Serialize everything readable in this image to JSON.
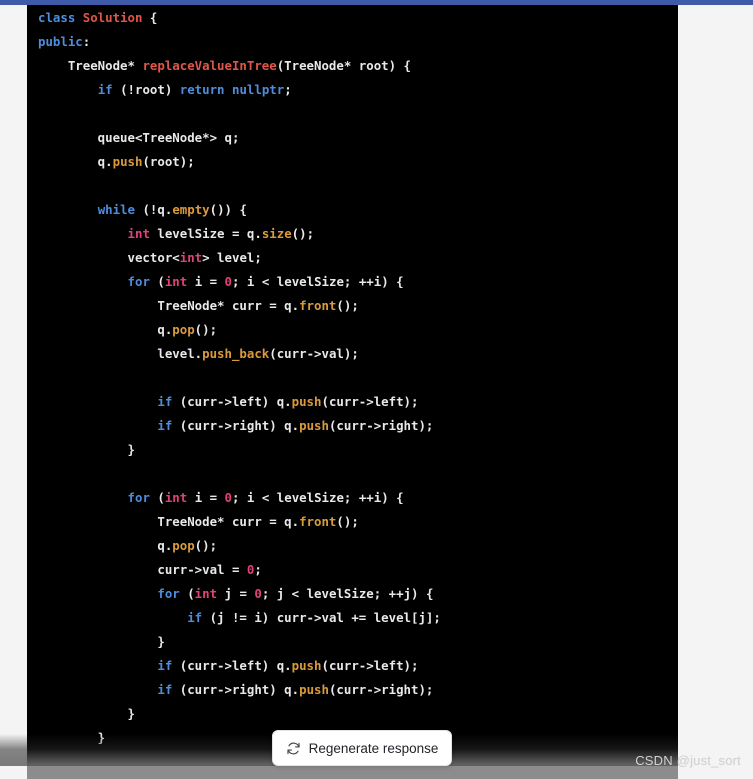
{
  "window": {
    "background_color": "#f4f4f4",
    "accent_bar_color": "#3e5aa9"
  },
  "code_block": {
    "language": "cpp",
    "background_color": "#000000",
    "theme_colors": {
      "keyword": "#4f8ddc",
      "class_name": "#e0564a",
      "function_name": "#e0564a",
      "type": "#e0417c",
      "number": "#e0417c",
      "method": "#d99b3c",
      "plain": "#e9e9e9"
    },
    "lines": [
      [
        {
          "t": "class ",
          "c": "t-key"
        },
        {
          "t": "Solution",
          "c": "t-cls"
        },
        {
          "t": " {",
          "c": "t-plain"
        }
      ],
      [
        {
          "t": "public",
          "c": "t-key"
        },
        {
          "t": ":",
          "c": "t-plain"
        }
      ],
      [
        {
          "t": "    TreeNode* ",
          "c": "t-plain"
        },
        {
          "t": "replaceValueInTree",
          "c": "t-fn"
        },
        {
          "t": "(TreeNode* root) {",
          "c": "t-plain"
        }
      ],
      [
        {
          "t": "        ",
          "c": "t-plain"
        },
        {
          "t": "if",
          "c": "t-key"
        },
        {
          "t": " (!root) ",
          "c": "t-plain"
        },
        {
          "t": "return",
          "c": "t-key"
        },
        {
          "t": " ",
          "c": "t-plain"
        },
        {
          "t": "nullptr",
          "c": "t-key"
        },
        {
          "t": ";",
          "c": "t-plain"
        }
      ],
      [
        {
          "t": "",
          "c": "t-plain"
        }
      ],
      [
        {
          "t": "        queue<TreeNode*> q;",
          "c": "t-plain"
        }
      ],
      [
        {
          "t": "        q.",
          "c": "t-plain"
        },
        {
          "t": "push",
          "c": "t-meth"
        },
        {
          "t": "(root);",
          "c": "t-plain"
        }
      ],
      [
        {
          "t": "",
          "c": "t-plain"
        }
      ],
      [
        {
          "t": "        ",
          "c": "t-plain"
        },
        {
          "t": "while",
          "c": "t-key"
        },
        {
          "t": " (!q.",
          "c": "t-plain"
        },
        {
          "t": "empty",
          "c": "t-meth"
        },
        {
          "t": "()) {",
          "c": "t-plain"
        }
      ],
      [
        {
          "t": "            ",
          "c": "t-plain"
        },
        {
          "t": "int",
          "c": "t-type"
        },
        {
          "t": " levelSize = q.",
          "c": "t-plain"
        },
        {
          "t": "size",
          "c": "t-meth"
        },
        {
          "t": "();",
          "c": "t-plain"
        }
      ],
      [
        {
          "t": "            vector<",
          "c": "t-plain"
        },
        {
          "t": "int",
          "c": "t-type"
        },
        {
          "t": "> level;",
          "c": "t-plain"
        }
      ],
      [
        {
          "t": "            ",
          "c": "t-plain"
        },
        {
          "t": "for",
          "c": "t-key"
        },
        {
          "t": " (",
          "c": "t-plain"
        },
        {
          "t": "int",
          "c": "t-type"
        },
        {
          "t": " i = ",
          "c": "t-plain"
        },
        {
          "t": "0",
          "c": "t-num"
        },
        {
          "t": "; i < levelSize; ++i) {",
          "c": "t-plain"
        }
      ],
      [
        {
          "t": "                TreeNode* curr = q.",
          "c": "t-plain"
        },
        {
          "t": "front",
          "c": "t-meth"
        },
        {
          "t": "();",
          "c": "t-plain"
        }
      ],
      [
        {
          "t": "                q.",
          "c": "t-plain"
        },
        {
          "t": "pop",
          "c": "t-meth"
        },
        {
          "t": "();",
          "c": "t-plain"
        }
      ],
      [
        {
          "t": "                level.",
          "c": "t-plain"
        },
        {
          "t": "push_back",
          "c": "t-meth"
        },
        {
          "t": "(curr->val);",
          "c": "t-plain"
        }
      ],
      [
        {
          "t": "",
          "c": "t-plain"
        }
      ],
      [
        {
          "t": "                ",
          "c": "t-plain"
        },
        {
          "t": "if",
          "c": "t-key"
        },
        {
          "t": " (curr->left) q.",
          "c": "t-plain"
        },
        {
          "t": "push",
          "c": "t-meth"
        },
        {
          "t": "(curr->left);",
          "c": "t-plain"
        }
      ],
      [
        {
          "t": "                ",
          "c": "t-plain"
        },
        {
          "t": "if",
          "c": "t-key"
        },
        {
          "t": " (curr->right) q.",
          "c": "t-plain"
        },
        {
          "t": "push",
          "c": "t-meth"
        },
        {
          "t": "(curr->right);",
          "c": "t-plain"
        }
      ],
      [
        {
          "t": "            }",
          "c": "t-plain"
        }
      ],
      [
        {
          "t": "",
          "c": "t-plain"
        }
      ],
      [
        {
          "t": "            ",
          "c": "t-plain"
        },
        {
          "t": "for",
          "c": "t-key"
        },
        {
          "t": " (",
          "c": "t-plain"
        },
        {
          "t": "int",
          "c": "t-type"
        },
        {
          "t": " i = ",
          "c": "t-plain"
        },
        {
          "t": "0",
          "c": "t-num"
        },
        {
          "t": "; i < levelSize; ++i) {",
          "c": "t-plain"
        }
      ],
      [
        {
          "t": "                TreeNode* curr = q.",
          "c": "t-plain"
        },
        {
          "t": "front",
          "c": "t-meth"
        },
        {
          "t": "();",
          "c": "t-plain"
        }
      ],
      [
        {
          "t": "                q.",
          "c": "t-plain"
        },
        {
          "t": "pop",
          "c": "t-meth"
        },
        {
          "t": "();",
          "c": "t-plain"
        }
      ],
      [
        {
          "t": "                curr->val = ",
          "c": "t-plain"
        },
        {
          "t": "0",
          "c": "t-num"
        },
        {
          "t": ";",
          "c": "t-plain"
        }
      ],
      [
        {
          "t": "                ",
          "c": "t-plain"
        },
        {
          "t": "for",
          "c": "t-key"
        },
        {
          "t": " (",
          "c": "t-plain"
        },
        {
          "t": "int",
          "c": "t-type"
        },
        {
          "t": " j = ",
          "c": "t-plain"
        },
        {
          "t": "0",
          "c": "t-num"
        },
        {
          "t": "; j < levelSize; ++j) {",
          "c": "t-plain"
        }
      ],
      [
        {
          "t": "                    ",
          "c": "t-plain"
        },
        {
          "t": "if",
          "c": "t-key"
        },
        {
          "t": " (j != i) curr->val += level[j];",
          "c": "t-plain"
        }
      ],
      [
        {
          "t": "                }",
          "c": "t-plain"
        }
      ],
      [
        {
          "t": "                ",
          "c": "t-plain"
        },
        {
          "t": "if",
          "c": "t-key"
        },
        {
          "t": " (curr->left) q.",
          "c": "t-plain"
        },
        {
          "t": "push",
          "c": "t-meth"
        },
        {
          "t": "(curr->left);",
          "c": "t-plain"
        }
      ],
      [
        {
          "t": "                ",
          "c": "t-plain"
        },
        {
          "t": "if",
          "c": "t-key"
        },
        {
          "t": " (curr->right) q.",
          "c": "t-plain"
        },
        {
          "t": "push",
          "c": "t-meth"
        },
        {
          "t": "(curr->right);",
          "c": "t-plain"
        }
      ],
      [
        {
          "t": "            }",
          "c": "t-plain"
        }
      ],
      [
        {
          "t": "        }",
          "c": "t-plain"
        }
      ],
      [
        {
          "t": "",
          "c": "t-plain"
        }
      ]
    ]
  },
  "regenerate_button": {
    "label": "Regenerate response",
    "icon": "refresh-icon"
  },
  "watermark": {
    "text": "CSDN @just_sort"
  }
}
